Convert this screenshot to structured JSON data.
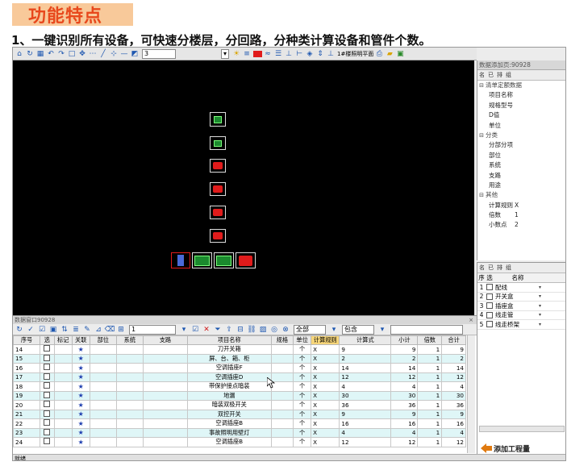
{
  "header": {
    "banner": "功能特点",
    "subtitle": "1、一键识别所有设备，可快速分楼层，分回路，分种类计算设备和管件个数。"
  },
  "toolbar": {
    "layer_value": "3",
    "floor_label": "1#楼照明平面"
  },
  "properties_panel": {
    "title": "数据添加页:90928",
    "tools": [
      "名",
      "已",
      "排",
      "组"
    ],
    "categories": [
      {
        "name": "清单定额数据",
        "rows": [
          {
            "key": "项目名称",
            "value": ""
          },
          {
            "key": "规格型号",
            "value": ""
          },
          {
            "key": "D值",
            "value": ""
          },
          {
            "key": "单位",
            "value": ""
          }
        ]
      },
      {
        "name": "分类",
        "rows": [
          {
            "key": "分部分项",
            "value": ""
          },
          {
            "key": "部位",
            "value": ""
          },
          {
            "key": "系统",
            "value": ""
          },
          {
            "key": "支路",
            "value": ""
          },
          {
            "key": "用途",
            "value": ""
          }
        ]
      },
      {
        "name": "其他",
        "rows": [
          {
            "key": "计算规则",
            "value": "X"
          },
          {
            "key": "倍数",
            "value": "1"
          },
          {
            "key": "小数点",
            "value": "2"
          }
        ]
      }
    ]
  },
  "category_list": {
    "headers": {
      "num": "序",
      "sel": "选",
      "name": "名称"
    },
    "items": [
      {
        "num": "1",
        "name": "配线"
      },
      {
        "num": "2",
        "name": "开关盒"
      },
      {
        "num": "3",
        "name": "插座盒"
      },
      {
        "num": "4",
        "name": "线走管"
      },
      {
        "num": "5",
        "name": "线走桥架"
      }
    ],
    "add_button": "添加工程量"
  },
  "bottom_panel": {
    "title": "数据窗口90928",
    "close": "×",
    "field1": "1",
    "filter_all": "全部",
    "filter_contains": "包含",
    "columns": [
      "序号",
      "选",
      "标记",
      "关联",
      "部位",
      "系统",
      "支路",
      "项目名称",
      "规格",
      "单位",
      "计算规则",
      "计算式",
      "小计",
      "倍数",
      "合计"
    ],
    "rows": [
      {
        "n": "14",
        "name": "刀开关箱",
        "unit": "个",
        "rule": "X",
        "expr": "9",
        "sub": "9",
        "mul": "1",
        "total": "9"
      },
      {
        "n": "15",
        "name": "屏、台、箱、柜",
        "unit": "个",
        "rule": "X",
        "expr": "2",
        "sub": "2",
        "mul": "1",
        "total": "2"
      },
      {
        "n": "16",
        "name": "空调插座F",
        "unit": "个",
        "rule": "X",
        "expr": "14",
        "sub": "14",
        "mul": "1",
        "total": "14"
      },
      {
        "n": "17",
        "name": "空调插座D",
        "unit": "个",
        "rule": "X",
        "expr": "12",
        "sub": "12",
        "mul": "1",
        "total": "12"
      },
      {
        "n": "18",
        "name": "带保护接点暗装",
        "unit": "个",
        "rule": "X",
        "expr": "4",
        "sub": "4",
        "mul": "1",
        "total": "4"
      },
      {
        "n": "19",
        "name": "地漏",
        "unit": "个",
        "rule": "X",
        "expr": "30",
        "sub": "30",
        "mul": "1",
        "total": "30"
      },
      {
        "n": "20",
        "name": "暗装双极开关",
        "unit": "个",
        "rule": "X",
        "expr": "36",
        "sub": "36",
        "mul": "1",
        "total": "36"
      },
      {
        "n": "21",
        "name": "双控开关",
        "unit": "个",
        "rule": "X",
        "expr": "9",
        "sub": "9",
        "mul": "1",
        "total": "9"
      },
      {
        "n": "22",
        "name": "空调插座B",
        "unit": "个",
        "rule": "X",
        "expr": "16",
        "sub": "16",
        "mul": "1",
        "total": "16"
      },
      {
        "n": "23",
        "name": "事故照明用壁灯",
        "unit": "个",
        "rule": "X",
        "expr": "4",
        "sub": "4",
        "mul": "1",
        "total": "4"
      },
      {
        "n": "24",
        "name": "空调插座B",
        "unit": "个",
        "rule": "X",
        "expr": "12",
        "sub": "12",
        "mul": "1",
        "total": "12"
      }
    ]
  },
  "status": {
    "text": "就绪"
  }
}
